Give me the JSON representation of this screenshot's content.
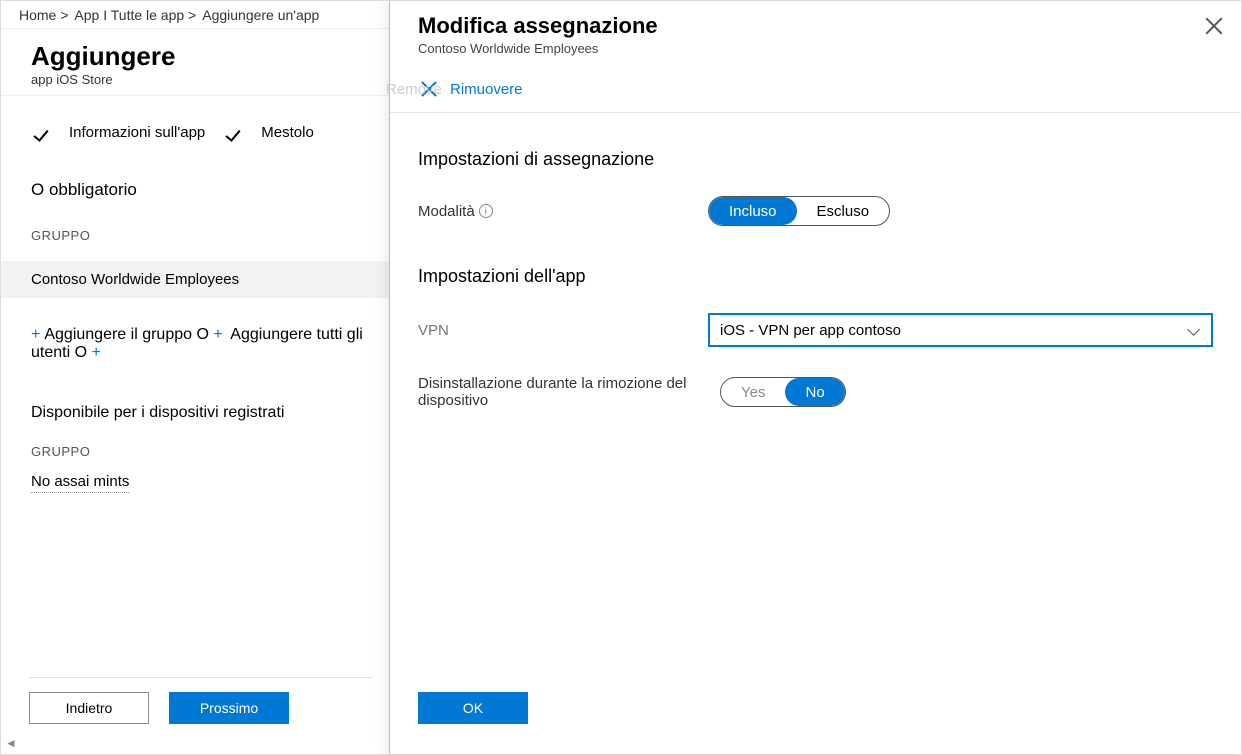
{
  "breadcrumb": {
    "home": "Home >",
    "apps": "App I Tutte le app >",
    "add": "Aggiungere un'app"
  },
  "left": {
    "title": "Aggiungere",
    "subtitle": "app iOS Store",
    "step1": "Informazioni sull'app",
    "step2": "Mestolo",
    "required": "O obbligatorio",
    "group_label": "GRUPPO",
    "group_value": "Contoso Worldwide Employees",
    "add_group": "Aggiungere il gruppo O",
    "add_users": "Aggiungere tutti gli utenti O",
    "available": "Disponibile per i dispositivi registrati",
    "group_label2": "GRUPPO",
    "no_assign": "No assai mints",
    "back": "Indietro",
    "next": "Prossimo"
  },
  "right": {
    "title": "Modifica assegnazione",
    "subtitle": "Contoso Worldwide Employees",
    "remove": "Rimuovere",
    "remove_ghost": "Remove",
    "section1": "Impostazioni di assegnazione",
    "mode_label": "Modalità",
    "mode_included": "Incluso",
    "mode_excluded": "Escluso",
    "section2": "Impostazioni dell'app",
    "vpn_label": "VPN",
    "vpn_value": "iOS - VPN per app contoso",
    "uninstall_label": "Disinstallazione durante la rimozione del dispositivo",
    "uninstall_yes": "Yes",
    "uninstall_no": "No",
    "ok": "OK"
  }
}
